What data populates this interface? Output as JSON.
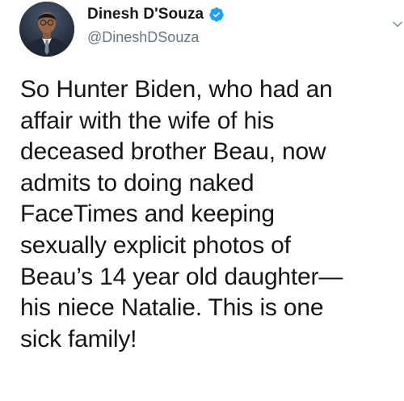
{
  "author": {
    "display_name": "Dinesh D'Souza",
    "handle": "@DineshDSouza",
    "verified": true,
    "avatar_icon": "profile-photo",
    "verified_icon": "verified-badge-icon",
    "menu_icon": "chevron-down-icon"
  },
  "tweet": {
    "text": "So Hunter Biden, who had an\naffair with the wife of his\ndeceased brother Beau, now\nadmits to doing naked\nFaceTimes and keeping\nsexually explicit photos of\nBeau’s 14 year old daughter—\nhis niece Natalie. This is one\nsick family!"
  },
  "colors": {
    "text": "#14171a",
    "secondary_text": "#66757f",
    "verified_blue": "#1da1f2",
    "background": "#ffffff"
  }
}
